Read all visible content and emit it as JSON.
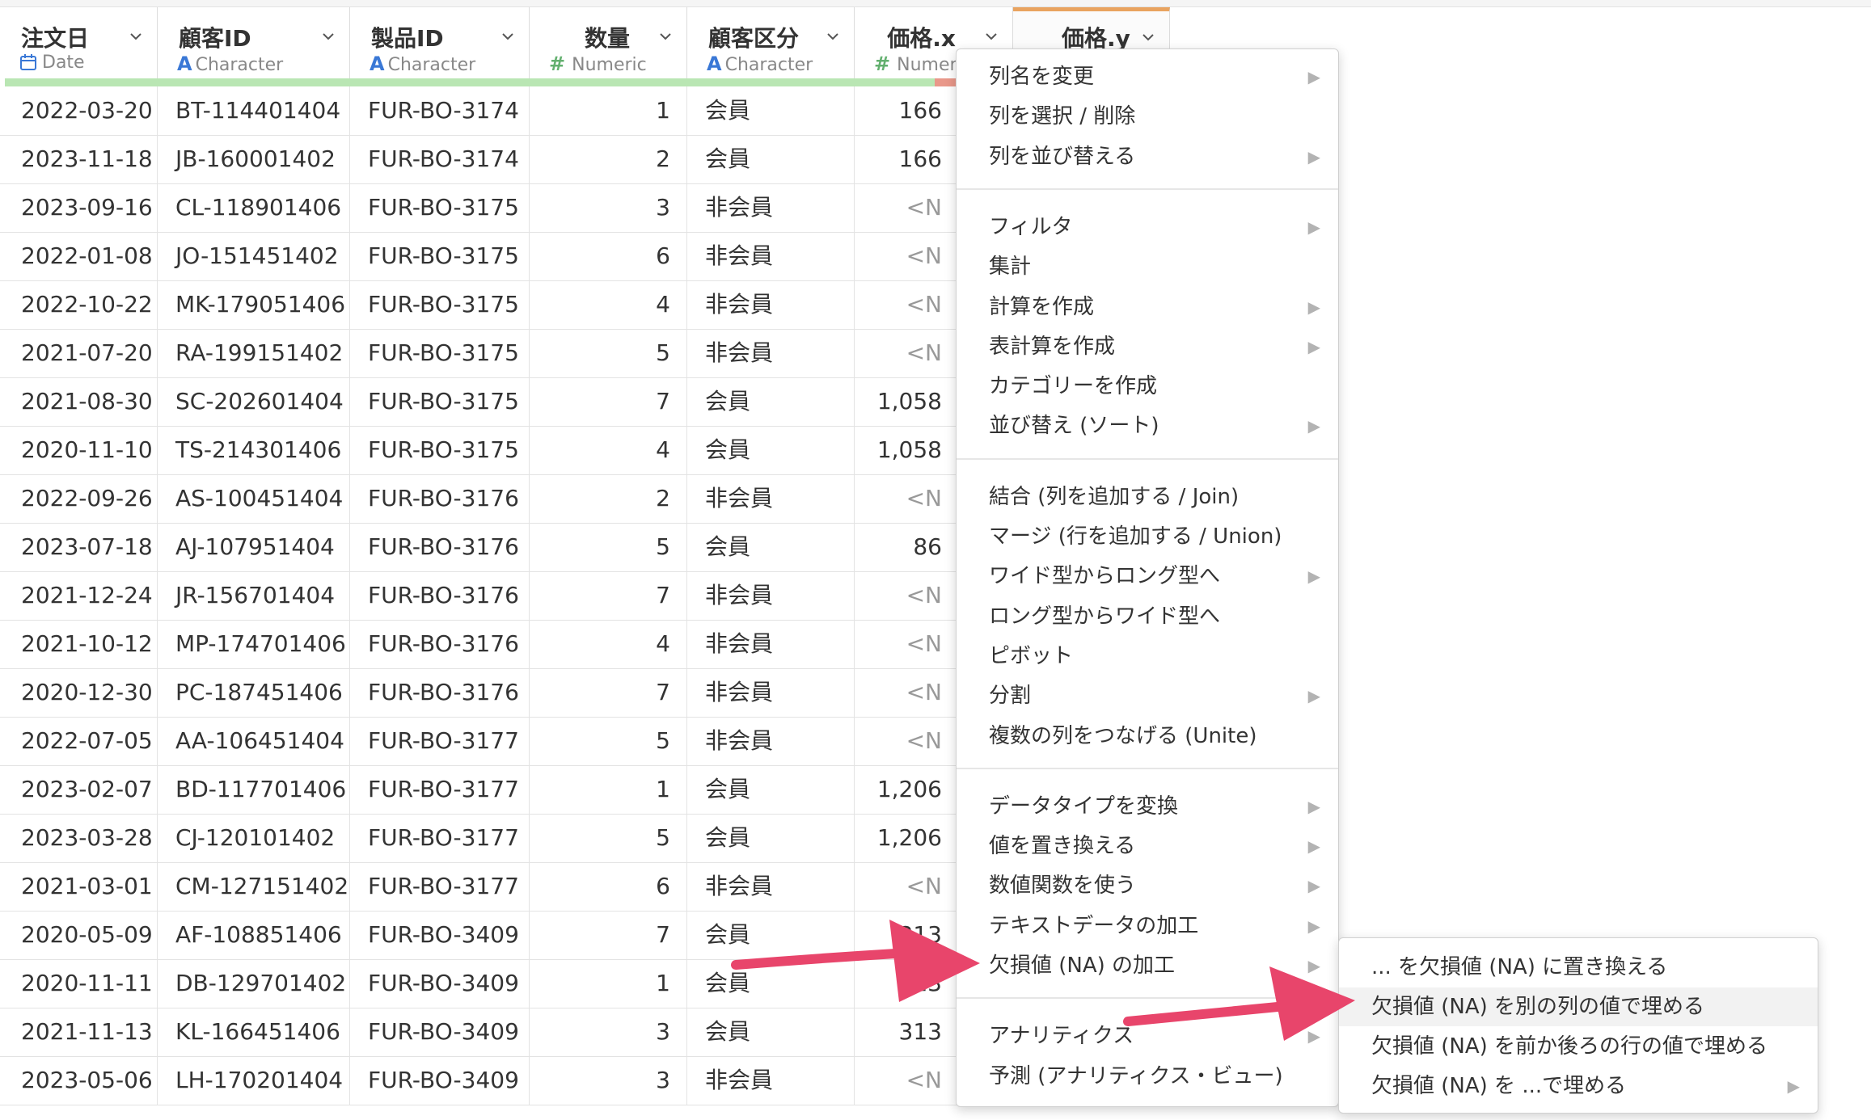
{
  "columns": [
    {
      "name": "注文日",
      "type": "Date",
      "type_icon": "calendar-icon"
    },
    {
      "name": "顧客ID",
      "type": "Character",
      "type_icon": "A"
    },
    {
      "name": "製品ID",
      "type": "Character",
      "type_icon": "A"
    },
    {
      "name": "数量",
      "type": "Numeric",
      "type_icon": "#"
    },
    {
      "name": "顧客区分",
      "type": "Character",
      "type_icon": "A"
    },
    {
      "name": "価格.x",
      "type": "Numeric",
      "type_icon": "#"
    },
    {
      "name": "価格.y",
      "type": "",
      "type_icon": ""
    }
  ],
  "rows": [
    [
      "2022-03-20",
      "BT-114401404",
      "FUR-BO-3174",
      "1",
      "会員",
      "166"
    ],
    [
      "2023-11-18",
      "JB-160001402",
      "FUR-BO-3174",
      "2",
      "会員",
      "166"
    ],
    [
      "2023-09-16",
      "CL-118901406",
      "FUR-BO-3175",
      "3",
      "非会員",
      "<N"
    ],
    [
      "2022-01-08",
      "JO-151451402",
      "FUR-BO-3175",
      "6",
      "非会員",
      "<N"
    ],
    [
      "2022-10-22",
      "MK-179051406",
      "FUR-BO-3175",
      "4",
      "非会員",
      "<N"
    ],
    [
      "2021-07-20",
      "RA-199151402",
      "FUR-BO-3175",
      "5",
      "非会員",
      "<N"
    ],
    [
      "2021-08-30",
      "SC-202601404",
      "FUR-BO-3175",
      "7",
      "会員",
      "1,058"
    ],
    [
      "2020-11-10",
      "TS-214301406",
      "FUR-BO-3175",
      "4",
      "会員",
      "1,058"
    ],
    [
      "2022-09-26",
      "AS-100451404",
      "FUR-BO-3176",
      "2",
      "非会員",
      "<N"
    ],
    [
      "2023-07-18",
      "AJ-107951404",
      "FUR-BO-3176",
      "5",
      "会員",
      "86"
    ],
    [
      "2021-12-24",
      "JR-156701404",
      "FUR-BO-3176",
      "7",
      "非会員",
      "<N"
    ],
    [
      "2021-10-12",
      "MP-174701406",
      "FUR-BO-3176",
      "4",
      "非会員",
      "<N"
    ],
    [
      "2020-12-30",
      "PC-187451406",
      "FUR-BO-3176",
      "7",
      "非会員",
      "<N"
    ],
    [
      "2022-07-05",
      "AA-106451404",
      "FUR-BO-3177",
      "5",
      "非会員",
      "<N"
    ],
    [
      "2023-02-07",
      "BD-117701406",
      "FUR-BO-3177",
      "1",
      "会員",
      "1,206"
    ],
    [
      "2023-03-28",
      "CJ-120101402",
      "FUR-BO-3177",
      "5",
      "会員",
      "1,206"
    ],
    [
      "2021-03-01",
      "CM-127151402",
      "FUR-BO-3177",
      "6",
      "非会員",
      "<N"
    ],
    [
      "2020-05-09",
      "AF-108851406",
      "FUR-BO-3409",
      "7",
      "会員",
      "313"
    ],
    [
      "2020-11-11",
      "DB-129701402",
      "FUR-BO-3409",
      "1",
      "会員",
      "313"
    ],
    [
      "2021-11-13",
      "KL-166451406",
      "FUR-BO-3409",
      "3",
      "会員",
      "313"
    ],
    [
      "2023-05-06",
      "LH-170201404",
      "FUR-BO-3409",
      "3",
      "非会員",
      "<N"
    ]
  ],
  "context_menu": {
    "groups": [
      [
        {
          "label": "列名を変更",
          "sub": true
        },
        {
          "label": "列を選択 / 削除",
          "sub": false
        },
        {
          "label": "列を並び替える",
          "sub": true
        }
      ],
      [
        {
          "label": "フィルタ",
          "sub": true
        },
        {
          "label": "集計",
          "sub": false
        },
        {
          "label": "計算を作成",
          "sub": true
        },
        {
          "label": "表計算を作成",
          "sub": true
        },
        {
          "label": "カテゴリーを作成",
          "sub": false
        },
        {
          "label": "並び替え (ソート)",
          "sub": true
        }
      ],
      [
        {
          "label": "結合 (列を追加する / Join)",
          "sub": false
        },
        {
          "label": "マージ (行を追加する / Union)",
          "sub": false
        },
        {
          "label": "ワイド型からロング型へ",
          "sub": true
        },
        {
          "label": "ロング型からワイド型へ",
          "sub": false
        },
        {
          "label": "ピボット",
          "sub": false
        },
        {
          "label": "分割",
          "sub": true
        },
        {
          "label": "複数の列をつなげる (Unite)",
          "sub": false
        }
      ],
      [
        {
          "label": "データタイプを変換",
          "sub": true
        },
        {
          "label": "値を置き換える",
          "sub": true
        },
        {
          "label": "数値関数を使う",
          "sub": true
        },
        {
          "label": "テキストデータの加工",
          "sub": true
        },
        {
          "label": "欠損値 (NA) の加工",
          "sub": true
        }
      ],
      [
        {
          "label": "アナリティクス",
          "sub": true
        },
        {
          "label": "予測 (アナリティクス・ビュー)",
          "sub": false
        }
      ]
    ]
  },
  "submenu": {
    "items": [
      {
        "label": "... を欠損値 (NA) に置き換える",
        "sub": false
      },
      {
        "label": "欠損値 (NA) を別の列の値で埋める",
        "sub": false,
        "highlighted": true
      },
      {
        "label": "欠損値 (NA) を前か後ろの行の値で埋める",
        "sub": false
      },
      {
        "label": "欠損値 (NA) を ...で埋める",
        "sub": true
      }
    ]
  },
  "colors": {
    "arrow": "#e8456b",
    "accent_border": "#e9a35f",
    "quality_ok": "#b9e6b3",
    "quality_bad": "#e9988a"
  }
}
